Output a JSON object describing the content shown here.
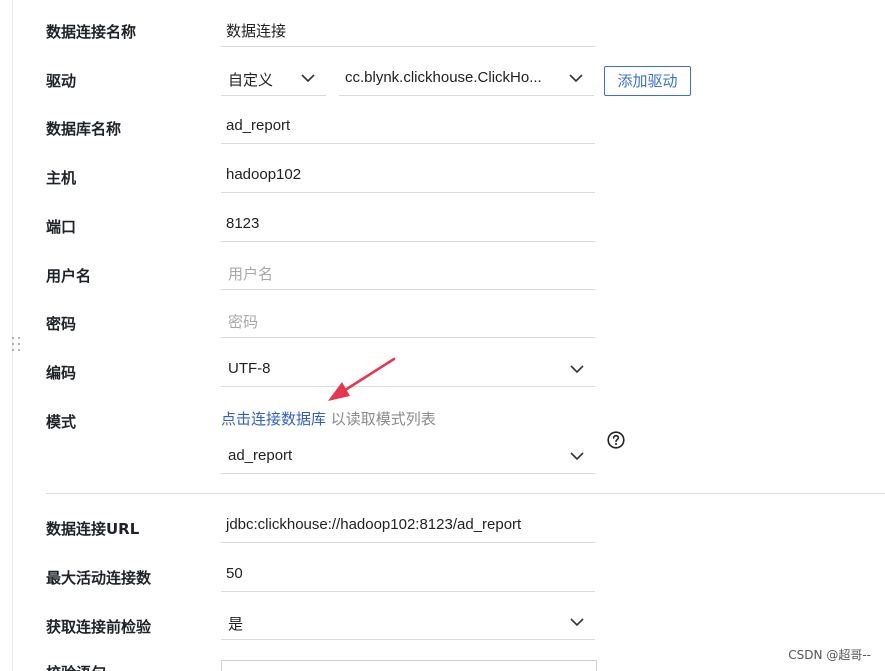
{
  "form": {
    "connection_name": {
      "label": "数据连接名称",
      "value": "数据连接"
    },
    "driver": {
      "label": "驱动",
      "type_value": "自定义",
      "class_value": "cc.blynk.clickhouse.ClickHo...",
      "add_button": "添加驱动"
    },
    "database_name": {
      "label": "数据库名称",
      "value": "ad_report"
    },
    "host": {
      "label": "主机",
      "value": "hadoop102"
    },
    "port": {
      "label": "端口",
      "value": "8123"
    },
    "username": {
      "label": "用户名",
      "placeholder": "用户名"
    },
    "password": {
      "label": "密码",
      "placeholder": "密码"
    },
    "encoding": {
      "label": "编码",
      "value": "UTF-8"
    },
    "schema": {
      "label": "模式",
      "hint_link": "点击连接数据库",
      "hint_rest": " 以读取模式列表",
      "value": "ad_report"
    },
    "url": {
      "label": "数据连接URL",
      "value": "jdbc:clickhouse://hadoop102:8123/ad_report"
    },
    "max_active": {
      "label": "最大活动连接数",
      "value": "50"
    },
    "test_before_get": {
      "label": "获取连接前检验",
      "value": "是"
    },
    "validation_query": {
      "label": "校验语句"
    }
  },
  "icons": {
    "chevron": "chevron-down-icon",
    "help": "question-circle-icon",
    "drag": "drag-handle-icon",
    "annotation": "red-arrow-annotation"
  },
  "colors": {
    "link": "#2e5fd0",
    "button_border": "#3b6fd4",
    "annotation": "#e8344e"
  },
  "watermark": "CSDN @超哥--"
}
